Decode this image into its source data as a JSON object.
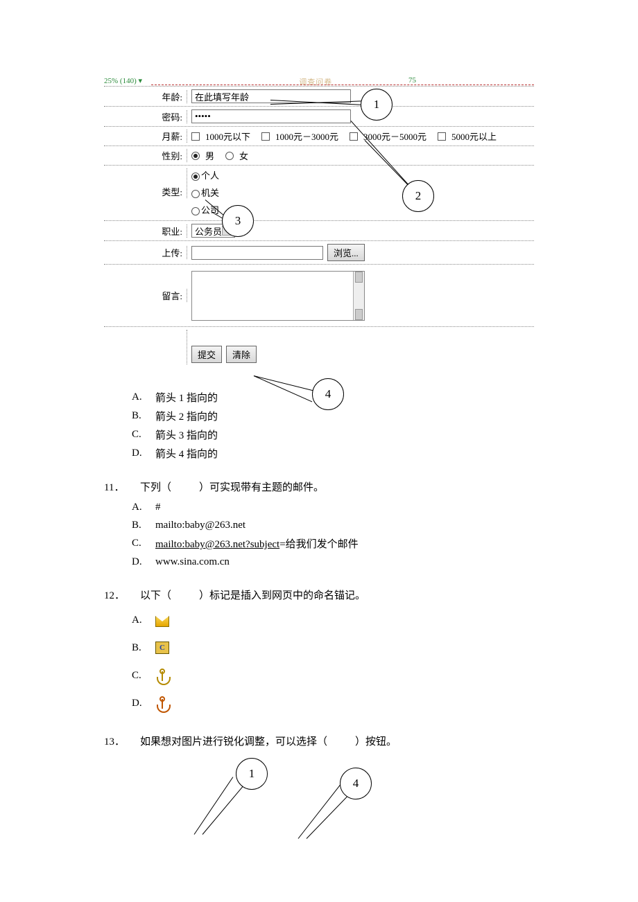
{
  "ruler": {
    "left": "25% (140) ▾",
    "midTitle": "调查问卷",
    "right": "75"
  },
  "form": {
    "age": {
      "label": "年龄:",
      "value": "在此填写年龄"
    },
    "password": {
      "label": "密码:",
      "value": "•••••"
    },
    "salary": {
      "label": "月薪:",
      "opts": [
        "1000元以下",
        "1000元－3000元",
        "3000元－5000元",
        "5000元以上"
      ]
    },
    "gender": {
      "label": "性别:",
      "opts": [
        "男",
        "女"
      ]
    },
    "type": {
      "label": "类型:",
      "opts": [
        "个人",
        "机关",
        "公司"
      ]
    },
    "job": {
      "label": "职业:",
      "value": "公务员"
    },
    "upload": {
      "label": "上传:",
      "value": "",
      "browse": "浏览..."
    },
    "msg": {
      "label": "留言:"
    },
    "submit": "提交",
    "clear": "清除"
  },
  "callouts": {
    "c1": "1",
    "c2": "2",
    "c3": "3",
    "c4": "4"
  },
  "q10": {
    "opts": [
      {
        "letter": "A.",
        "text": "箭头 1 指向的"
      },
      {
        "letter": "B.",
        "text": "箭头 2 指向的"
      },
      {
        "letter": "C.",
        "text": "箭头 3 指向的"
      },
      {
        "letter": "D.",
        "text": "箭头 4 指向的"
      }
    ]
  },
  "q11": {
    "num": "11．",
    "text_a": "下列（",
    "text_b": "）可实现带有主题的邮件。",
    "opts": [
      {
        "letter": "A.",
        "text": "#"
      },
      {
        "letter": "B.",
        "text": "mailto:baby@263.net"
      },
      {
        "letter": "C.",
        "text_a": "mailto:baby@263.net?subject",
        "text_b": "=给我们发个邮件"
      },
      {
        "letter": "D.",
        "text": "www.sina.com.cn"
      }
    ]
  },
  "q12": {
    "num": "12．",
    "text_a": "以下（",
    "text_b": "）标记是插入到网页中的命名锚记。",
    "letters": [
      "A.",
      "B.",
      "C.",
      "D."
    ],
    "iconC": "C"
  },
  "q13": {
    "num": "13．",
    "text_a": "如果想对图片进行锐化调整，可以选择（",
    "text_b": "）按钮。",
    "c1": "1",
    "c4": "4"
  }
}
